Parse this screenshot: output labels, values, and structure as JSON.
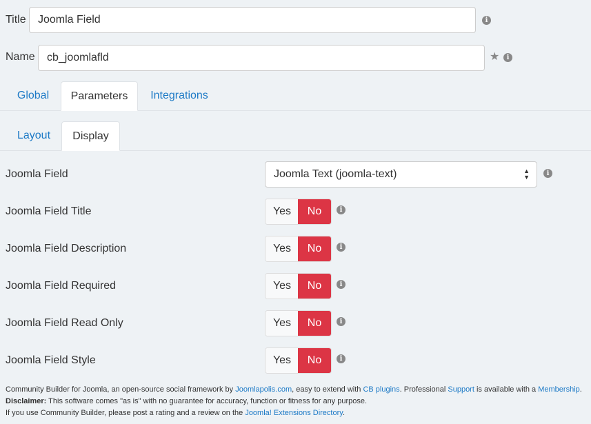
{
  "form": {
    "title_label": "Title",
    "title_value": "Joomla Field",
    "name_label": "Name",
    "name_value": "cb_joomlafld"
  },
  "main_tabs": [
    {
      "label": "Global",
      "active": false
    },
    {
      "label": "Parameters",
      "active": true
    },
    {
      "label": "Integrations",
      "active": false
    }
  ],
  "sub_tabs": [
    {
      "label": "Layout",
      "active": false
    },
    {
      "label": "Display",
      "active": true
    }
  ],
  "params": {
    "joomla_field": {
      "label": "Joomla Field",
      "selected": "Joomla Text (joomla-text)"
    },
    "rows": [
      {
        "label": "Joomla Field Title",
        "yes": "Yes",
        "no": "No",
        "value": "No"
      },
      {
        "label": "Joomla Field Description",
        "yes": "Yes",
        "no": "No",
        "value": "No"
      },
      {
        "label": "Joomla Field Required",
        "yes": "Yes",
        "no": "No",
        "value": "No"
      },
      {
        "label": "Joomla Field Read Only",
        "yes": "Yes",
        "no": "No",
        "value": "No"
      },
      {
        "label": "Joomla Field Style",
        "yes": "Yes",
        "no": "No",
        "value": "No"
      }
    ]
  },
  "footer": {
    "line1_a": "Community Builder for Joomla, an open-source social framework by ",
    "link_joomlapolis": "Joomlapolis.com",
    "line1_b": ", easy to extend with ",
    "link_cb_plugins": "CB plugins",
    "line1_c": ". Professional ",
    "link_support": "Support",
    "line1_d": " is available with a ",
    "link_membership": "Membership",
    "line1_e": ".",
    "disclaimer_label": "Disclaimer:",
    "disclaimer_text": " This software comes \"as is\" with no guarantee for accuracy, function or fitness for any purpose.",
    "line3_a": "If you use Community Builder, please post a rating and a review on the ",
    "link_jed": "Joomla! Extensions Directory",
    "line3_b": "."
  },
  "colors": {
    "accent": "#1d7ac6",
    "no_active": "#dc3545",
    "background": "#eef2f5"
  }
}
